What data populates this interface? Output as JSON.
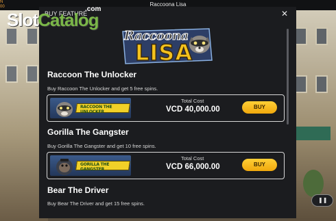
{
  "window": {
    "title": "Raccoona Lisa"
  },
  "watermark": {
    "prefix": "Slot",
    "accent": "Catalog",
    "suffix": ".com"
  },
  "modal": {
    "header_title": "BUY FEATURE",
    "close_glyph": "✕",
    "game_logo": {
      "line1": "Raccoona",
      "line2": "LISA"
    },
    "items": [
      {
        "title": "Raccoon The Unlocker",
        "description": "Buy Raccoon The Unlocker and get 5 free spins.",
        "thumb_label": "RACCOON THE UNLOCKER",
        "cost_label": "Total Cost",
        "cost_value": "VCD 40,000.00",
        "buy_label": "BUY"
      },
      {
        "title": "Gorilla The Gangster",
        "description": "Buy Gorilla The Gangster and get 10 free spins.",
        "thumb_label": "GORILLA THE GANGSTER",
        "cost_label": "Total Cost",
        "cost_value": "VCD 66,000.00",
        "buy_label": "BUY"
      },
      {
        "title": "Bear The Driver",
        "description": "Buy Bear The Driver and get 15 free spins."
      }
    ]
  },
  "controls": {
    "play_glyph": "❚❚"
  },
  "colors": {
    "accent": "#f4c21d",
    "buy_button": "#ffc21f",
    "watermark_green": "#7ab648"
  }
}
